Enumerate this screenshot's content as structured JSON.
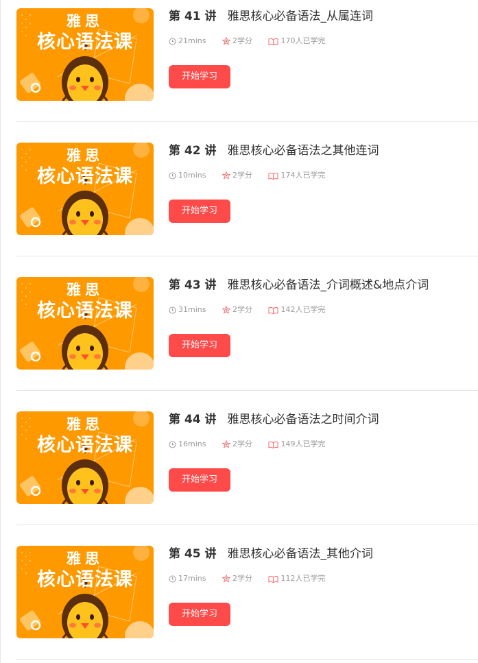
{
  "thumbnail": {
    "line1": "雅思",
    "line2": "核心语法课"
  },
  "colors": {
    "thumb_bg": "#ff9900",
    "button": "#ff4a4a",
    "meta_icon": "#ff6b6b"
  },
  "icons": {
    "clock": "clock-icon",
    "credit": "star-icon",
    "learners": "open-book-icon"
  },
  "lessons": [
    {
      "num": "第 41 讲",
      "title": "雅思核心必备语法_从属连词",
      "duration": "21mins",
      "credit": "2学分",
      "learners": "170人已学完",
      "button": "开始学习"
    },
    {
      "num": "第 42 讲",
      "title": "雅思核心必备语法之其他连词",
      "duration": "10mins",
      "credit": "2学分",
      "learners": "174人已学完",
      "button": "开始学习"
    },
    {
      "num": "第 43 讲",
      "title": "雅思核心必备语法_介词概述&地点介词",
      "duration": "31mins",
      "credit": "2学分",
      "learners": "142人已学完",
      "button": "开始学习"
    },
    {
      "num": "第 44 讲",
      "title": "雅思核心必备语法之时间介词",
      "duration": "16mins",
      "credit": "2学分",
      "learners": "149人已学完",
      "button": "开始学习"
    },
    {
      "num": "第 45 讲",
      "title": "雅思核心必备语法_其他介词",
      "duration": "17mins",
      "credit": "2学分",
      "learners": "112人已学完",
      "button": "开始学习"
    }
  ]
}
